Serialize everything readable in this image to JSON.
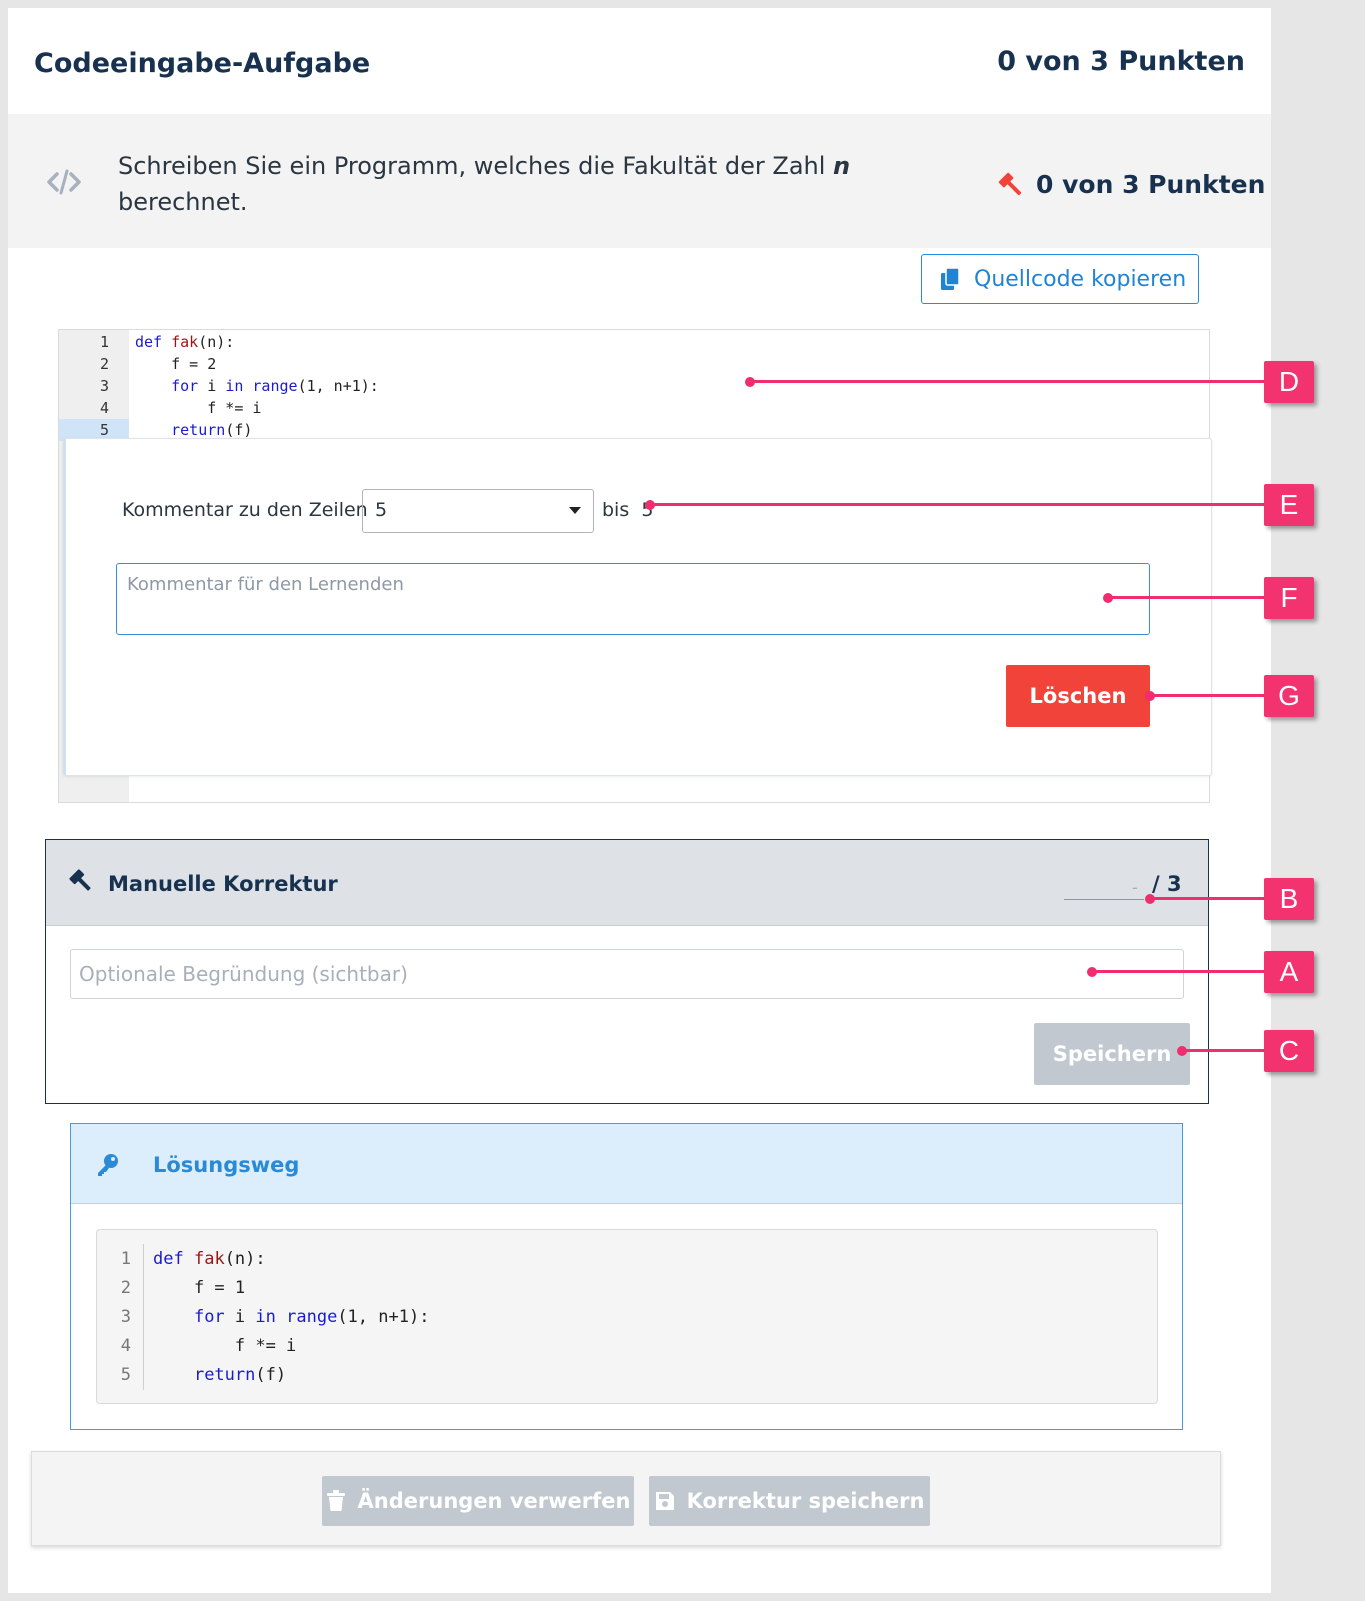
{
  "header": {
    "title": "Codeeingabe-Aufgabe",
    "points": "0 von 3 Punkten"
  },
  "task": {
    "description_prefix": "Schreiben Sie ein Programm, welches die Fakultät der Zahl ",
    "description_var": "n",
    "description_suffix": "berechnet.",
    "points": "0 von 3 Punkten",
    "code_icon": "code-icon",
    "hammer_icon": "gavel-icon"
  },
  "copy_button": {
    "label": "Quellcode kopieren",
    "icon": "copy-icon"
  },
  "editor": {
    "line_numbers": [
      "1",
      "2",
      "3",
      "4",
      "5"
    ],
    "active_line": "5",
    "lines": [
      "def fak(n):",
      "    f = 2",
      "    for i in range(1, n+1):",
      "        f *= i",
      "    return(f)"
    ]
  },
  "comment": {
    "label": "Kommentar zu den Zeilen",
    "from_value": "5",
    "bis_label": "bis",
    "to_value": "5",
    "placeholder": "Kommentar für den Lernenden",
    "delete_label": "Löschen"
  },
  "manual_correction": {
    "title": "Manuelle Korrektur",
    "score_value": "-",
    "score_max": "/ 3",
    "reason_placeholder": "Optionale Begründung (sichtbar)",
    "save_label": "Speichern"
  },
  "solution": {
    "title": "Lösungsweg",
    "line_numbers": [
      "1",
      "2",
      "3",
      "4",
      "5"
    ],
    "lines": [
      "def fak(n):",
      "    f = 1",
      "    for i in range(1, n+1):",
      "        f *= i",
      "    return(f)"
    ]
  },
  "footer": {
    "discard_label": "Änderungen verwerfen",
    "save_label": "Korrektur speichern"
  },
  "callouts": [
    "D",
    "E",
    "F",
    "G",
    "B",
    "A",
    "C"
  ],
  "colors": {
    "accent": "#1f84d4",
    "danger": "#f2433a",
    "callout": "#f3336f",
    "navy": "#17314f"
  }
}
